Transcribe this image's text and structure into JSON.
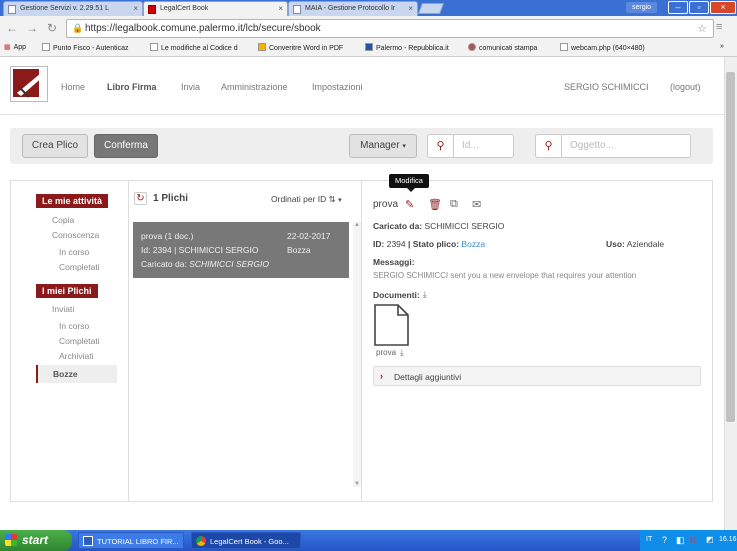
{
  "browser": {
    "tabs": [
      {
        "label": "Gestione Servizi v. 2.29.51 L"
      },
      {
        "label": "LegalCert Book"
      },
      {
        "label": "MAIA - Gestione Protocollo Ir"
      }
    ],
    "user_label": "sergio",
    "url": "https://legalbook.comune.palermo.it/lcb/secure/sbook",
    "bookmarks": [
      "App",
      "Punto Fisco - Autenticaz",
      "Le modifiche al Codice d",
      "Converitre Word in PDF",
      "Palermo - Repubblica.it",
      "comunicati stampa",
      "webcam.php (640×480)"
    ]
  },
  "nav": {
    "home": "Home",
    "libro_firma": "Libro Firma",
    "invia": "Invia",
    "amministrazione": "Amministrazione",
    "impostazioni": "Impostazioni",
    "user": "SERGIO SCHIMICCI",
    "logout": "(logout)"
  },
  "toolbar": {
    "crea_plico": "Crea Plico",
    "conferma": "Conferma",
    "manager": "Manager",
    "id_placeholder": "Id...",
    "oggetto_placeholder": "Oggetto..."
  },
  "sidebar": {
    "mie_attivita": "Le mie attività",
    "copia": "Copia",
    "conoscenza": "Conoscenza",
    "in_corso_1": "In corso",
    "completati_1": "Completati",
    "miei_plichi": "I miei Plichi",
    "inviati": "Inviati",
    "in_corso_2": "In corso",
    "completati_2": "Completati",
    "archiviati": "Archiviati",
    "bozze": "Bozze"
  },
  "list": {
    "count_label": "1 Plichi",
    "sort_label": "Ordinati per ID",
    "item": {
      "title": "prova (1 doc.)",
      "date": "22-02-2017",
      "line2": "Id: 2394 | SCHIMICCI SERGIO",
      "status": "Bozza",
      "uploaded_prefix": "Caricato da: ",
      "uploaded_by": "SCHIMICCI SERGIO"
    }
  },
  "detail": {
    "tooltip": "Modifica",
    "title": "prova",
    "caricato_label": "Caricato da:",
    "caricato_value": "SCHIMICCI SERGIO",
    "id_label": "ID:",
    "id_value": "2394",
    "stato_label": "| Stato plico:",
    "stato_value": "Bozza",
    "uso_label": "Uso:",
    "uso_value": "Aziendale",
    "messaggi_label": "Messaggi:",
    "messaggio": "SERGIO SCHIMICCI sent you a new envelope that requires your attention",
    "documenti_label": "Documenti:",
    "doc_name": "prova",
    "dettagli": "Dettagli aggiuntivi"
  },
  "taskbar": {
    "start": "start",
    "tasks": [
      "TUTORIAL LIBRO FIR...",
      "LegalCert Book - Goo..."
    ],
    "lang": "IT",
    "time": "16.16"
  },
  "colors": {
    "accent": "#8b1a1a",
    "link": "#3a8fd0"
  }
}
